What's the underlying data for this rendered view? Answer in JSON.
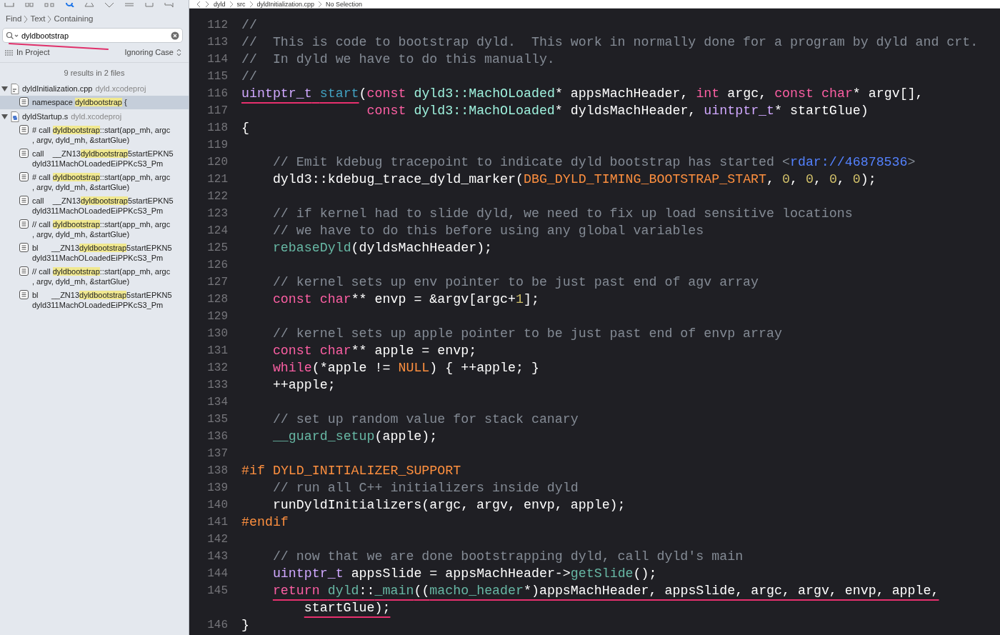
{
  "sidebar": {
    "scope_path": [
      "Find",
      "Text",
      "Containing"
    ],
    "search": {
      "value": "dyldbootstrap",
      "annotated": true
    },
    "scope": "In Project",
    "case_mode": "Ignoring Case",
    "summary": "9 results in 2 files",
    "files": [
      {
        "name": "dyldInitialization.cpp",
        "project": "dyld.xcodeproj",
        "expanded": true,
        "kind": "cpp",
        "results": [
          {
            "before": "namespace ",
            "match": "dyldbootstrap",
            "after": " {",
            "selected": true
          }
        ]
      },
      {
        "name": "dyldStartup.s",
        "project": "dyld.xcodeproj",
        "expanded": true,
        "kind": "asm",
        "results": [
          {
            "before": "# call ",
            "match": "dyldbootstrap",
            "after": "::start(app_mh, argc",
            "second_line": ", argv, dyld_mh, &startGlue)",
            "selected": false
          },
          {
            "before": "call    __ZN13",
            "match": "dyldbootstrap",
            "after": "5startEPKN5",
            "second_line": "dyld311MachOLoadedEiPPKcS3_Pm",
            "selected": false
          },
          {
            "before": "# call ",
            "match": "dyldbootstrap",
            "after": "::start(app_mh, argc",
            "second_line": ", argv, dyld_mh, &startGlue)",
            "selected": false
          },
          {
            "before": "call    __ZN13",
            "match": "dyldbootstrap",
            "after": "5startEPKN5",
            "second_line": "dyld311MachOLoadedEiPPKcS3_Pm",
            "selected": false
          },
          {
            "before": "// call ",
            "match": "dyldbootstrap",
            "after": "::start(app_mh, argc",
            "second_line": ", argv, dyld_mh, &startGlue)",
            "selected": false
          },
          {
            "before": "bl      __ZN13",
            "match": "dyldbootstrap",
            "after": "5startEPKN5",
            "second_line": "dyld311MachOLoadedEiPPKcS3_Pm",
            "selected": false
          },
          {
            "before": "// call ",
            "match": "dyldbootstrap",
            "after": "::start(app_mh, argc",
            "second_line": ", argv, dyld_mh, &startGlue)",
            "selected": false
          },
          {
            "before": "bl      __ZN13",
            "match": "dyldbootstrap",
            "after": "5startEPKN5",
            "second_line": "dyld311MachOLoadedEiPPKcS3_Pm",
            "selected": false
          }
        ]
      }
    ]
  },
  "jump_bar": [
    "dyld",
    "src",
    "dyldInitialization.cpp",
    "No Selection"
  ],
  "code": [
    {
      "num": "112",
      "tokens": [
        {
          "kind": "comment",
          "text": "//"
        }
      ]
    },
    {
      "num": "113",
      "tokens": [
        {
          "kind": "comment",
          "text": "//  This is code to bootstrap dyld.  This work in normally done for a program by dyld and crt."
        }
      ]
    },
    {
      "num": "114",
      "tokens": [
        {
          "kind": "comment",
          "text": "//  In dyld we have to do this manually."
        }
      ]
    },
    {
      "num": "115",
      "tokens": [
        {
          "kind": "comment",
          "text": "//"
        }
      ]
    },
    {
      "num": "116",
      "tokens": [
        {
          "kind": "type",
          "text": "uintptr_t",
          "marked": true
        },
        {
          "kind": "decl",
          "text": " start",
          "marked": true
        },
        {
          "kind": "plain",
          "text": "("
        },
        {
          "kind": "keyword",
          "text": "const"
        },
        {
          "kind": "class",
          "text": " dyld3::MachOLoaded"
        },
        {
          "kind": "plain",
          "text": "* appsMachHeader, "
        },
        {
          "kind": "keyword",
          "text": "int"
        },
        {
          "kind": "plain",
          "text": " argc, "
        },
        {
          "kind": "keyword",
          "text": "const"
        },
        {
          "kind": "keyword",
          "text": " char"
        },
        {
          "kind": "plain",
          "text": "* argv[],"
        }
      ]
    },
    {
      "num": "117",
      "tokens": [
        {
          "kind": "keyword",
          "text": "                const"
        },
        {
          "kind": "class",
          "text": " dyld3::MachOLoaded"
        },
        {
          "kind": "plain",
          "text": "* dyldsMachHeader, "
        },
        {
          "kind": "type",
          "text": "uintptr_t"
        },
        {
          "kind": "plain",
          "text": "* startGlue)"
        }
      ]
    },
    {
      "num": "118",
      "tokens": [
        {
          "kind": "plain",
          "text": "{"
        }
      ]
    },
    {
      "num": "119"
    },
    {
      "num": "120",
      "tokens": [
        {
          "kind": "comment",
          "text": "    // Emit kdebug tracepoint to indicate dyld bootstrap has started <"
        },
        {
          "kind": "link",
          "text": "rdar://46878536"
        },
        {
          "kind": "comment",
          "text": ">"
        }
      ]
    },
    {
      "num": "121",
      "tokens": [
        {
          "kind": "plain",
          "text": "    dyld3::kdebug_trace_dyld_marker("
        },
        {
          "kind": "macro",
          "text": "DBG_DYLD_TIMING_BOOTSTRAP_START"
        },
        {
          "kind": "plain",
          "text": ", "
        },
        {
          "kind": "number",
          "text": "0"
        },
        {
          "kind": "plain",
          "text": ", "
        },
        {
          "kind": "number",
          "text": "0"
        },
        {
          "kind": "plain",
          "text": ", "
        },
        {
          "kind": "number",
          "text": "0"
        },
        {
          "kind": "plain",
          "text": ", "
        },
        {
          "kind": "number",
          "text": "0"
        },
        {
          "kind": "plain",
          "text": ");"
        }
      ]
    },
    {
      "num": "122"
    },
    {
      "num": "123",
      "tokens": [
        {
          "kind": "comment",
          "text": "    // if kernel had to slide dyld, we need to fix up load sensitive locations"
        }
      ]
    },
    {
      "num": "124",
      "tokens": [
        {
          "kind": "comment",
          "text": "    // we have to do this before using any global variables"
        }
      ]
    },
    {
      "num": "125",
      "tokens": [
        {
          "kind": "call",
          "text": "    rebaseDyld"
        },
        {
          "kind": "plain",
          "text": "(dyldsMachHeader);"
        }
      ]
    },
    {
      "num": "126"
    },
    {
      "num": "127",
      "tokens": [
        {
          "kind": "comment",
          "text": "    // kernel sets up env pointer to be just past end of agv array"
        }
      ]
    },
    {
      "num": "128",
      "tokens": [
        {
          "kind": "keyword",
          "text": "    const"
        },
        {
          "kind": "keyword",
          "text": " char"
        },
        {
          "kind": "plain",
          "text": "** envp = &argv[argc+"
        },
        {
          "kind": "number",
          "text": "1"
        },
        {
          "kind": "plain",
          "text": "];"
        }
      ]
    },
    {
      "num": "129"
    },
    {
      "num": "130",
      "tokens": [
        {
          "kind": "comment",
          "text": "    // kernel sets up apple pointer to be just past end of envp array"
        }
      ]
    },
    {
      "num": "131",
      "tokens": [
        {
          "kind": "keyword",
          "text": "    const"
        },
        {
          "kind": "keyword",
          "text": " char"
        },
        {
          "kind": "plain",
          "text": "** apple = envp;"
        }
      ]
    },
    {
      "num": "132",
      "tokens": [
        {
          "kind": "keyword",
          "text": "    while"
        },
        {
          "kind": "plain",
          "text": "(*apple != "
        },
        {
          "kind": "macro",
          "text": "NULL"
        },
        {
          "kind": "plain",
          "text": ") { ++apple; }"
        }
      ]
    },
    {
      "num": "133",
      "tokens": [
        {
          "kind": "plain",
          "text": "    ++apple;"
        }
      ]
    },
    {
      "num": "134"
    },
    {
      "num": "135",
      "tokens": [
        {
          "kind": "comment",
          "text": "    // set up random value for stack canary"
        }
      ]
    },
    {
      "num": "136",
      "tokens": [
        {
          "kind": "call",
          "text": "    __guard_setup"
        },
        {
          "kind": "plain",
          "text": "(apple);"
        }
      ]
    },
    {
      "num": "137"
    },
    {
      "num": "138",
      "tokens": [
        {
          "kind": "preproc",
          "text": "#if"
        },
        {
          "kind": "macro",
          "text": " DYLD_INITIALIZER_SUPPORT"
        }
      ]
    },
    {
      "num": "139",
      "tokens": [
        {
          "kind": "comment",
          "text": "    // run all C++ initializers inside dyld"
        }
      ]
    },
    {
      "num": "140",
      "tokens": [
        {
          "kind": "plain",
          "text": "    runDyldInitializers(argc, argv, envp, apple);"
        }
      ]
    },
    {
      "num": "141",
      "tokens": [
        {
          "kind": "preproc",
          "text": "#endif"
        }
      ]
    },
    {
      "num": "142"
    },
    {
      "num": "143",
      "tokens": [
        {
          "kind": "comment",
          "text": "    // now that we are done bootstrapping dyld, call dyld's main"
        }
      ]
    },
    {
      "num": "144",
      "tokens": [
        {
          "kind": "type",
          "text": "    uintptr_t"
        },
        {
          "kind": "plain",
          "text": " appsSlide = appsMachHeader->"
        },
        {
          "kind": "call",
          "text": "getSlide"
        },
        {
          "kind": "plain",
          "text": "();"
        }
      ]
    },
    {
      "num": "145",
      "tokens": [
        {
          "kind": "keyword",
          "text": "    return",
          "marked": true
        },
        {
          "kind": "call",
          "text": " dyld",
          "marked": true
        },
        {
          "kind": "plain",
          "text": "::",
          "marked": true
        },
        {
          "kind": "call",
          "text": "_main",
          "marked": true
        },
        {
          "kind": "plain",
          "text": "((",
          "marked": true
        },
        {
          "kind": "call",
          "text": "macho_header",
          "marked": true
        },
        {
          "kind": "plain",
          "text": "*)appsMachHeader, appsSlide, argc, argv, envp, apple,",
          "marked": true
        }
      ],
      "wrap": [
        {
          "kind": "plain",
          "text": "        startGlue);",
          "marked": true
        }
      ]
    },
    {
      "num": "146",
      "tokens": [
        {
          "kind": "plain",
          "text": "}"
        }
      ]
    }
  ]
}
